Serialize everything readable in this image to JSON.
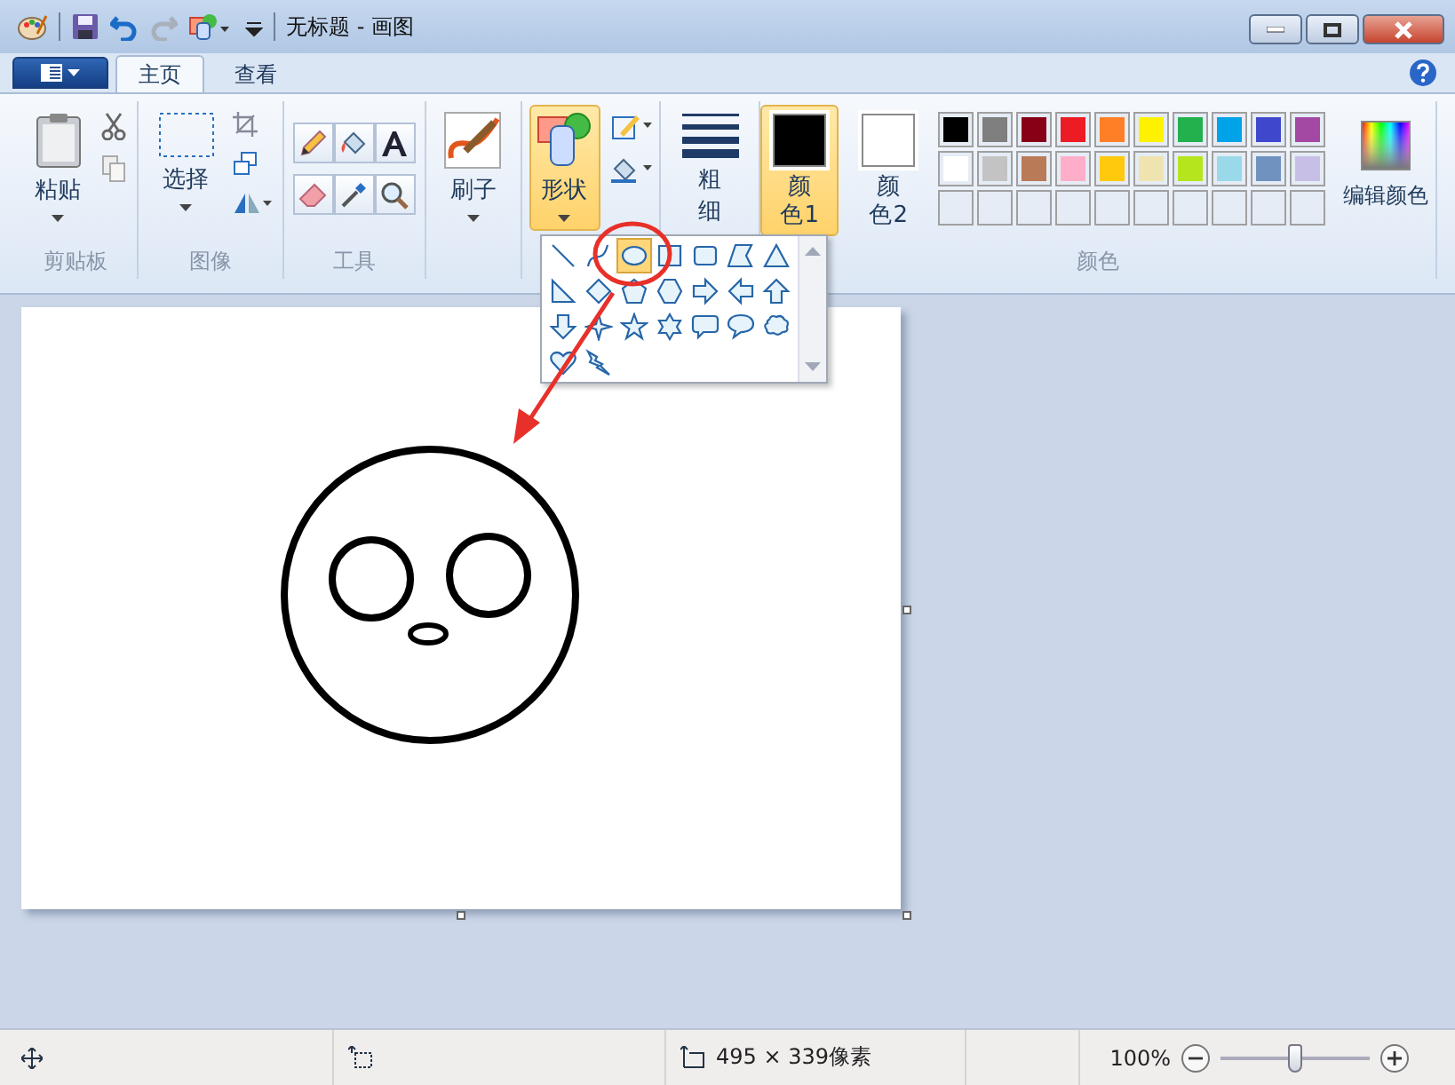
{
  "window": {
    "title": "无标题 - 画图"
  },
  "tabs": [
    {
      "label": "主页",
      "selected": true
    },
    {
      "label": "查看",
      "selected": false
    }
  ],
  "ribbon": {
    "clipboard": {
      "paste": "粘贴",
      "label": "剪贴板"
    },
    "image": {
      "select": "选择",
      "label": "图像"
    },
    "tools": {
      "label": "工具"
    },
    "brushes": {
      "label": "刷子"
    },
    "shapes": {
      "label": "形状",
      "selected": true
    },
    "size": {
      "label": "粗细"
    },
    "colors": {
      "label": "颜色",
      "color1": {
        "label": "颜色 1",
        "color": "#000000",
        "selected": true
      },
      "color2": {
        "label": "颜色 2",
        "color": "#ffffff",
        "selected": false
      },
      "edit": "编辑颜色",
      "palette": [
        {
          "color": "#000000"
        },
        {
          "color": "#7f7f7f"
        },
        {
          "color": "#880015"
        },
        {
          "color": "#ed1c24"
        },
        {
          "color": "#ff7f27"
        },
        {
          "color": "#fff200"
        },
        {
          "color": "#22b14c"
        },
        {
          "color": "#00a2e8"
        },
        {
          "color": "#3f48cc"
        },
        {
          "color": "#a349a4"
        },
        {
          "color": "#ffffff"
        },
        {
          "color": "#c3c3c3"
        },
        {
          "color": "#b97a57"
        },
        {
          "color": "#ffaec9"
        },
        {
          "color": "#ffc90e"
        },
        {
          "color": "#efe4b0"
        },
        {
          "color": "#b5e61d"
        },
        {
          "color": "#99d9ea"
        },
        {
          "color": "#7092be"
        },
        {
          "color": "#c8bfe7"
        }
      ]
    }
  },
  "shape_gallery": [
    {
      "kind": "line",
      "selected": false
    },
    {
      "kind": "curve",
      "selected": false
    },
    {
      "kind": "oval",
      "selected": true
    },
    {
      "kind": "rectangle",
      "selected": false
    },
    {
      "kind": "rounded-rectangle",
      "selected": false
    },
    {
      "kind": "polygon",
      "selected": false
    },
    {
      "kind": "triangle",
      "selected": false
    },
    {
      "kind": "right-triangle",
      "selected": false
    },
    {
      "kind": "diamond",
      "selected": false
    },
    {
      "kind": "pentagon",
      "selected": false
    },
    {
      "kind": "hexagon",
      "selected": false
    },
    {
      "kind": "right-arrow",
      "selected": false
    },
    {
      "kind": "left-arrow",
      "selected": false
    },
    {
      "kind": "up-arrow",
      "selected": false
    },
    {
      "kind": "down-arrow",
      "selected": false
    },
    {
      "kind": "four-point-star",
      "selected": false
    },
    {
      "kind": "five-point-star",
      "selected": false
    },
    {
      "kind": "six-point-star",
      "selected": false
    },
    {
      "kind": "rounded-callout",
      "selected": false
    },
    {
      "kind": "oval-callout",
      "selected": false
    },
    {
      "kind": "cloud-callout",
      "selected": false
    },
    {
      "kind": "heart",
      "selected": false
    },
    {
      "kind": "lightning",
      "selected": false
    }
  ],
  "status_bar": {
    "image_size": "495 × 339像素",
    "zoom": "100%",
    "zoom_slider": {
      "level": 0.5
    }
  }
}
